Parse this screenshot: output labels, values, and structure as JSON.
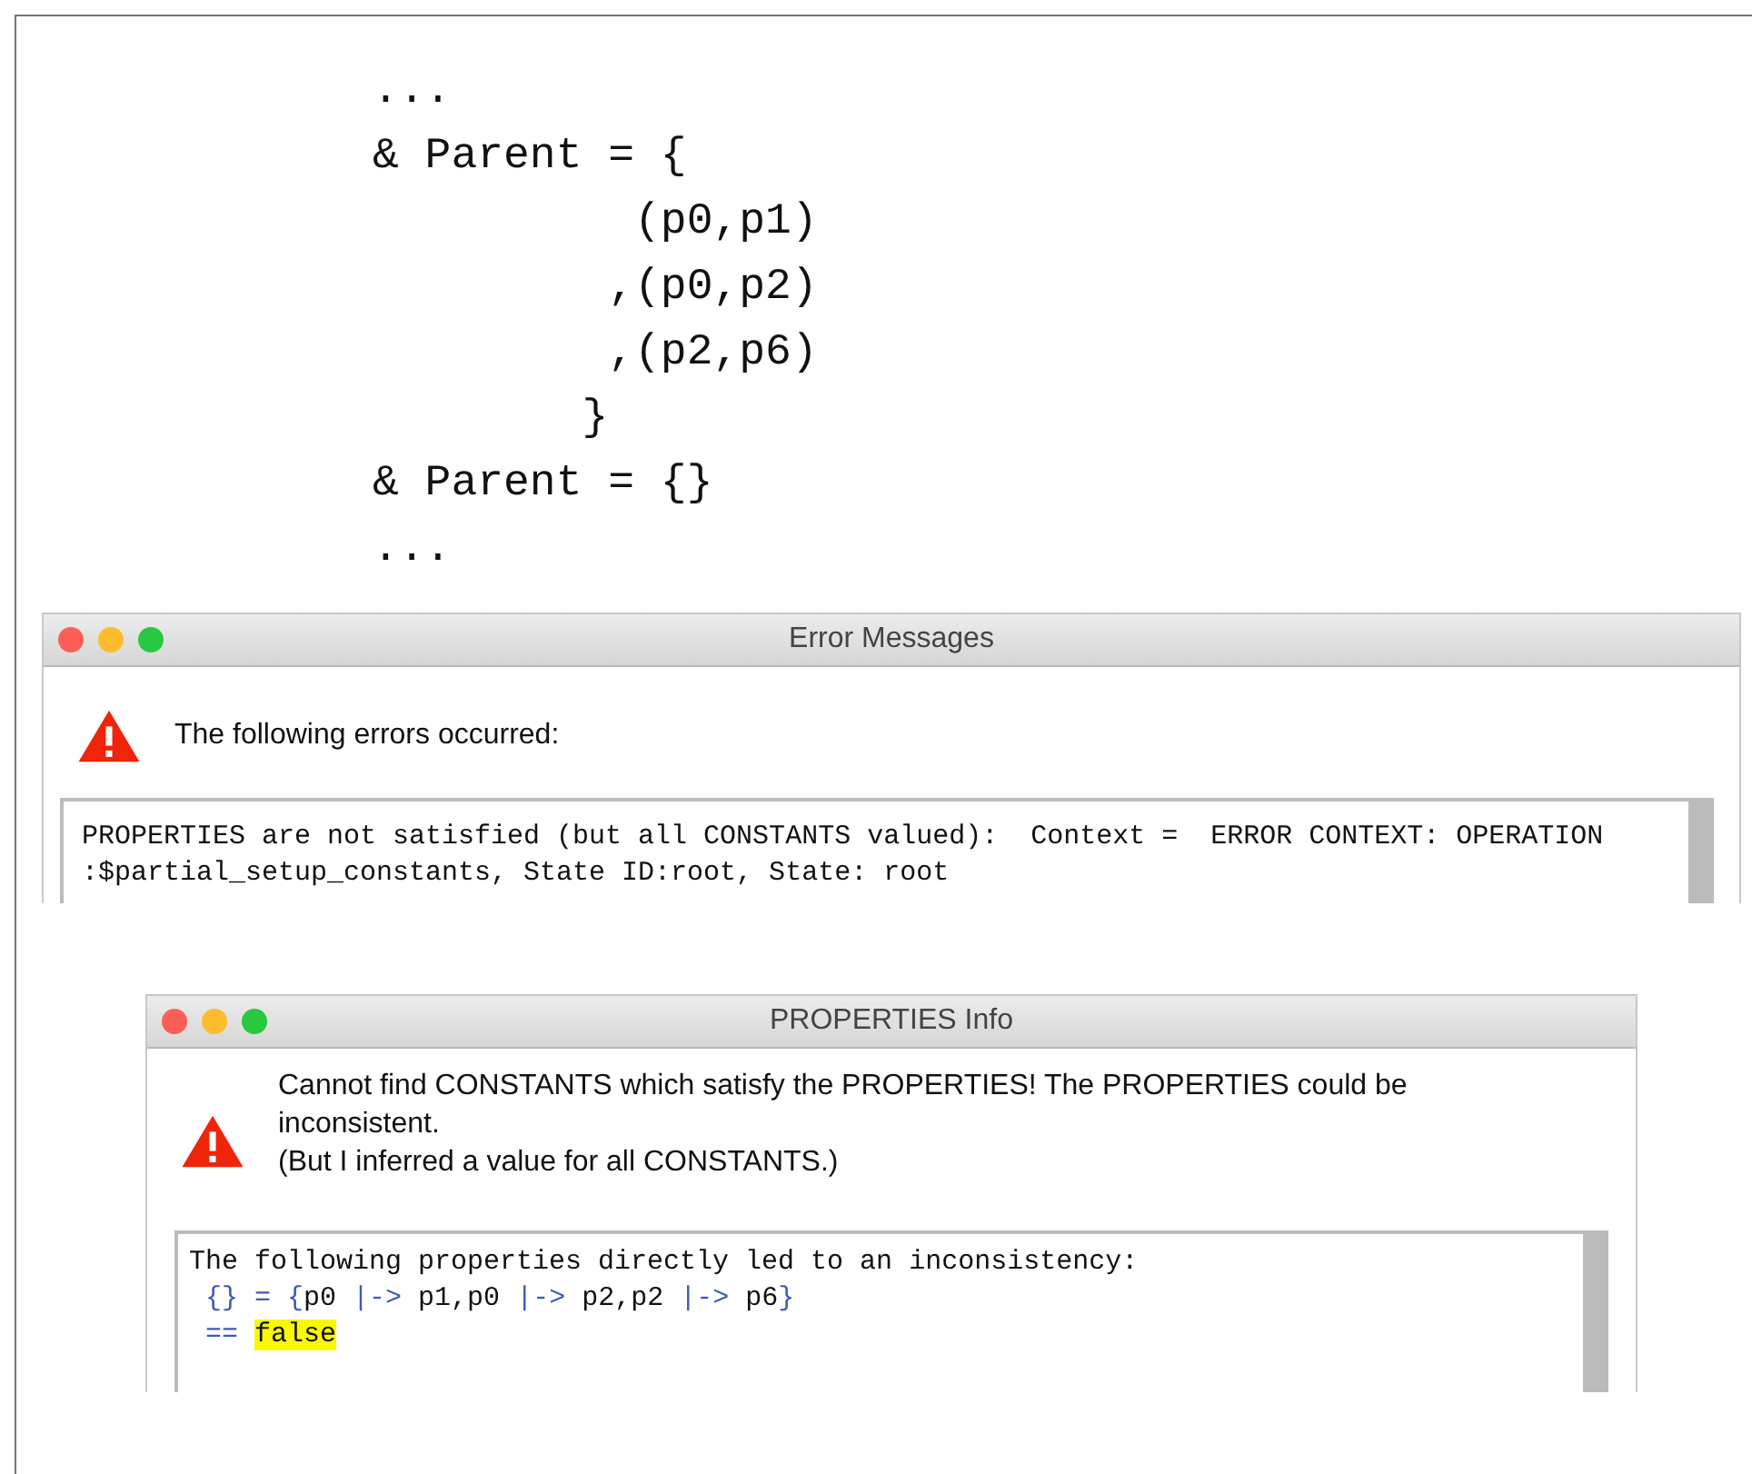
{
  "code_listing": {
    "lines": [
      "...",
      "& Parent = {",
      "          (p0,p1)",
      "         ,(p0,p2)",
      "         ,(p2,p6)",
      "        }",
      "& Parent = {}",
      "..."
    ]
  },
  "error_window": {
    "title": "Error Messages",
    "heading": "The following errors occurred:",
    "message_lines": [
      "PROPERTIES are not satisfied (but all CONSTANTS valued):  Context =  ERROR CONTEXT: OPERATION",
      ":$partial_setup_constants, State ID:root, State: root"
    ]
  },
  "properties_window": {
    "title": "PROPERTIES Info",
    "message_lines": [
      "Cannot find CONSTANTS which satisfy the PROPERTIES! The PROPERTIES could be inconsistent.",
      "(But I inferred a value for all CONSTANTS.)"
    ],
    "details": [
      [
        {
          "kind": "plain",
          "text": "The following properties directly led to an inconsistency:"
        }
      ],
      [
        {
          "kind": "operator",
          "text": " {} = {"
        },
        {
          "kind": "plain",
          "text": "p0 "
        },
        {
          "kind": "operator",
          "text": "|->"
        },
        {
          "kind": "plain",
          "text": " p1,p0 "
        },
        {
          "kind": "operator",
          "text": "|->"
        },
        {
          "kind": "plain",
          "text": " p2,p2 "
        },
        {
          "kind": "operator",
          "text": "|->"
        },
        {
          "kind": "plain",
          "text": " p6"
        },
        {
          "kind": "operator",
          "text": "}"
        }
      ],
      [
        {
          "kind": "operator",
          "text": " == "
        },
        {
          "kind": "highlight",
          "text": "false"
        }
      ]
    ]
  }
}
